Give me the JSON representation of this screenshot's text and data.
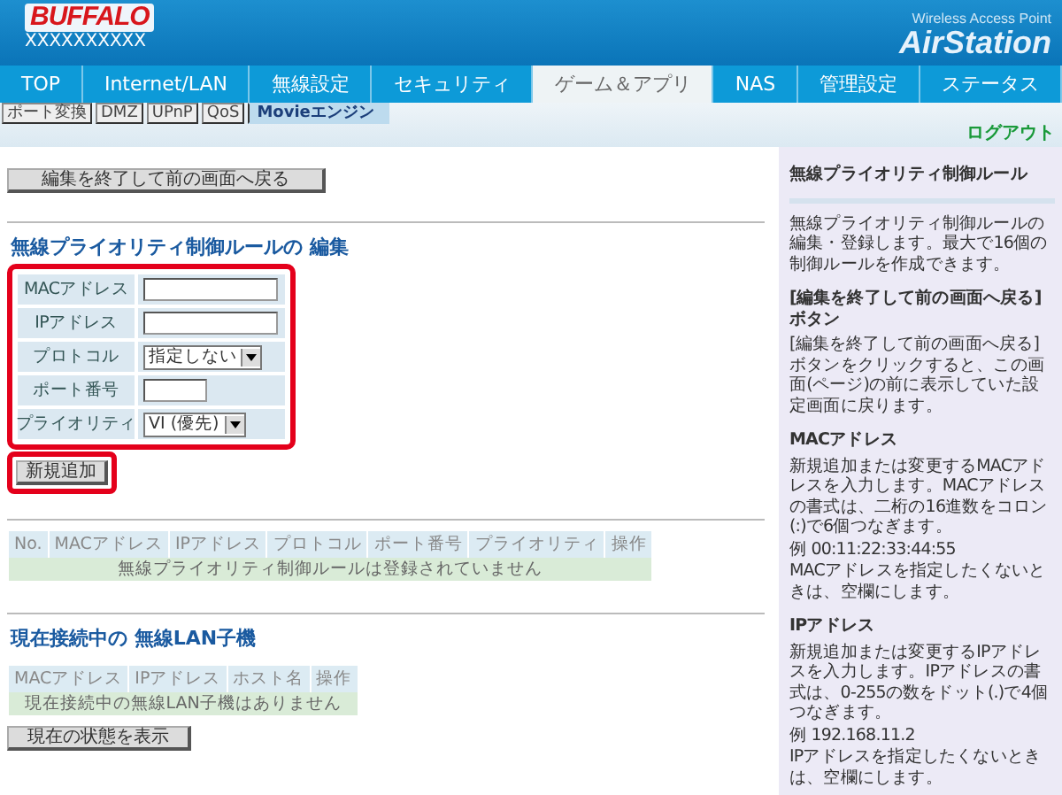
{
  "header": {
    "brand": "BUFFALO",
    "device_name": "XXXXXXXXXX",
    "product_tagline": "Wireless Access Point",
    "product_name": "AirStation"
  },
  "tabs": [
    {
      "label": "TOP",
      "selected": false
    },
    {
      "label": "Internet/LAN",
      "selected": false
    },
    {
      "label": "無線設定",
      "selected": false
    },
    {
      "label": "セキュリティ",
      "selected": false
    },
    {
      "label": "ゲーム＆アプリ",
      "selected": true
    },
    {
      "label": "NAS",
      "selected": false
    },
    {
      "label": "管理設定",
      "selected": false
    },
    {
      "label": "ステータス",
      "selected": false
    }
  ],
  "subtabs": [
    {
      "label": "ポート変換",
      "selected": false
    },
    {
      "label": "DMZ",
      "selected": false
    },
    {
      "label": "UPnP",
      "selected": false
    },
    {
      "label": "QoS",
      "selected": false
    },
    {
      "label": "Movieエンジン",
      "selected": true
    }
  ],
  "logout": "ログアウト",
  "back_button": "編集を終了して前の画面へ戻る",
  "edit_section": {
    "title": "無線プライオリティ制御ルールの 編集",
    "highlighted": true,
    "fields": [
      {
        "kind": "text",
        "label": "MACアドレス"
      },
      {
        "kind": "text",
        "label": "IPアドレス"
      },
      {
        "kind": "select",
        "label": "プロトコル",
        "value": "指定しない"
      },
      {
        "kind": "short_text",
        "label": "ポート番号"
      },
      {
        "kind": "select",
        "label": "プライオリティ",
        "value": "VI (優先)"
      }
    ]
  },
  "add_button": {
    "label": "新規追加",
    "highlighted": true
  },
  "rules_table": {
    "columns": [
      "No.",
      "MACアドレス",
      "IPアドレス",
      "プロトコル",
      "ポート番号",
      "プライオリティ",
      "操作"
    ],
    "empty_message": "無線プライオリティ制御ルールは登録されていません"
  },
  "clients_section": {
    "title": "現在接続中の 無線LAN子機",
    "columns": [
      "MACアドレス",
      "IPアドレス",
      "ホスト名",
      "操作"
    ],
    "empty_message": "現在接続中の無線LAN子機はありません"
  },
  "refresh_button": "現在の状態を表示",
  "help": {
    "title": "無線プライオリティ制御ルール",
    "intro": "無線プライオリティ制御ルールの編集・登録します。最大で16個の制御ルールを作成できます。",
    "sections": [
      {
        "heading": "[編集を終了して前の画面へ戻る]ボタン",
        "paragraphs": [
          "[編集を終了して前の画面へ戻る]ボタンをクリックすると、この画面(ページ)の前に表示していた設定画面に戻ります。"
        ]
      },
      {
        "heading": "MACアドレス",
        "paragraphs": [
          "新規追加または変更するMACアドレスを入力します。MACアドレスの書式は、二桁の16進数をコロン(:)で6個つなぎます。",
          "例 00:11:22:33:44:55",
          "MACアドレスを指定したくないときは、空欄にします。"
        ]
      },
      {
        "heading": "IPアドレス",
        "paragraphs": [
          "新規追加または変更するIPアドレスを入力します。IPアドレスの書式は、0-255の数をドット(.)で4個つなぎます。",
          "例 192.168.11.2",
          "IPアドレスを指定したくないときは、空欄にします。"
        ]
      }
    ]
  }
}
